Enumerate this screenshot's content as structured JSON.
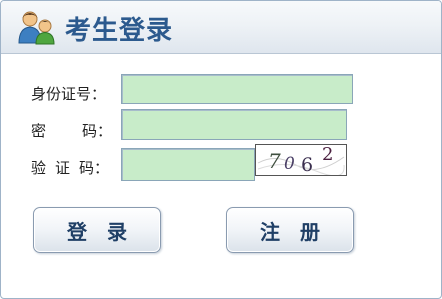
{
  "header": {
    "title": "考生登录",
    "icon": "users-icon"
  },
  "form": {
    "id_label": "身份证号：",
    "pwd_label_1": "密",
    "pwd_label_2": "码：",
    "code_label_1": "验",
    "code_label_2": "证",
    "code_label_3": "码：",
    "id_value": "",
    "pwd_value": "",
    "code_value": "",
    "captcha_text": "7062"
  },
  "buttons": {
    "login": "登录",
    "register": "注册"
  },
  "colors": {
    "title": "#2c5a8e",
    "input_bg": "#c8ecc9",
    "button_text": "#1f3f66"
  }
}
